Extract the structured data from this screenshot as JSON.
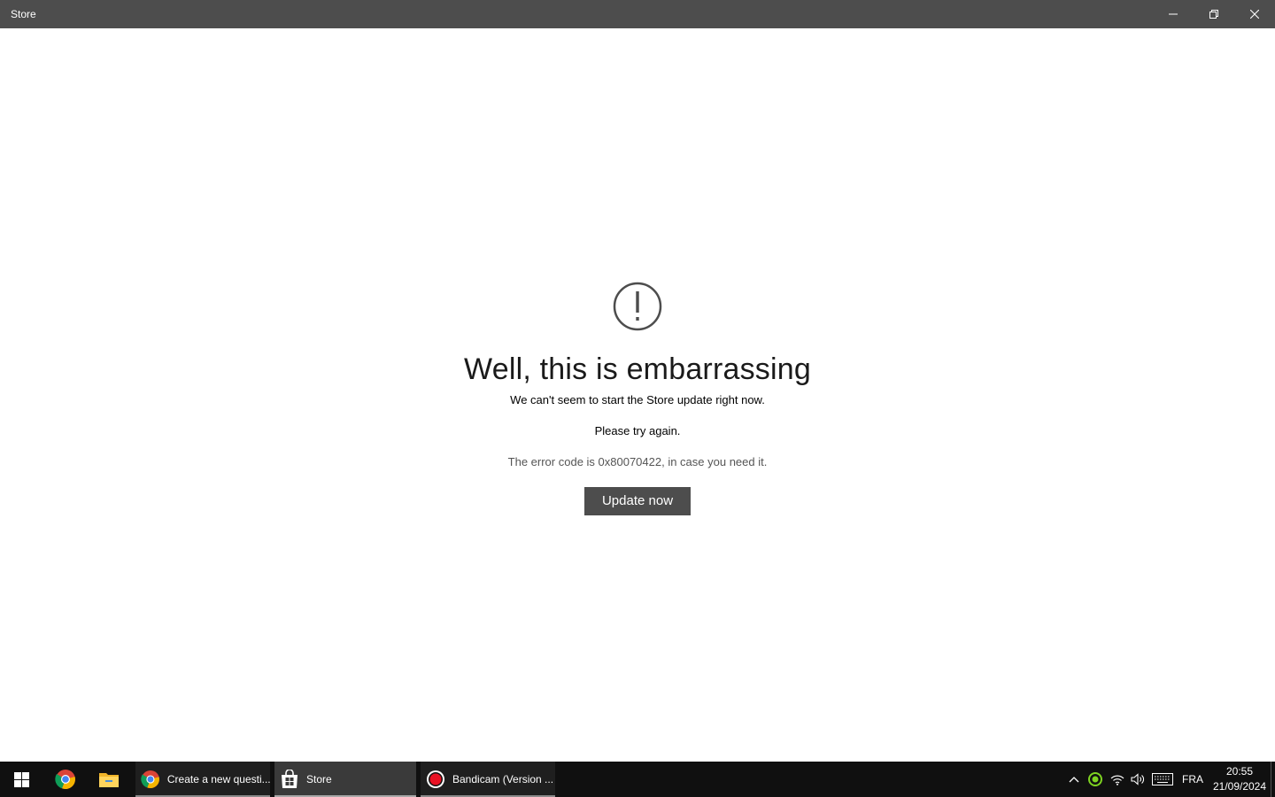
{
  "window": {
    "title": "Store",
    "controls": {
      "minimize": "minimize-icon",
      "maximize": "restore-icon",
      "close": "close-icon"
    }
  },
  "error": {
    "icon": "exclamation-circle-icon",
    "heading": "Well, this is embarrassing",
    "message": "We can't seem to start the Store update right now.",
    "retry_text": "Please try again.",
    "code_text": "The error code is 0x80070422, in case you need it.",
    "button_label": "Update now"
  },
  "taskbar": {
    "start_icon": "windows-logo-icon",
    "pinned": [
      "chrome-icon",
      "file-explorer-icon"
    ],
    "tasks": [
      {
        "icon": "chrome-icon",
        "label": "Create a new questi..."
      },
      {
        "icon": "store-icon",
        "label": "Store",
        "active": true
      },
      {
        "icon": "bandicam-record-icon",
        "label": "Bandicam (Version ..."
      }
    ],
    "tray": {
      "icons": [
        "show-hidden-icons-chevron",
        "green-status-icon",
        "network-icon",
        "volume-icon",
        "keyboard-icon"
      ],
      "language": "FRA",
      "time": "20:55",
      "date": "21/09/2024"
    }
  },
  "colors": {
    "titlebar": "#4d4d4d",
    "button": "#4d4d4d",
    "taskbar": "#101010",
    "record_red": "#e81123",
    "tray_green": "#7ed321"
  }
}
